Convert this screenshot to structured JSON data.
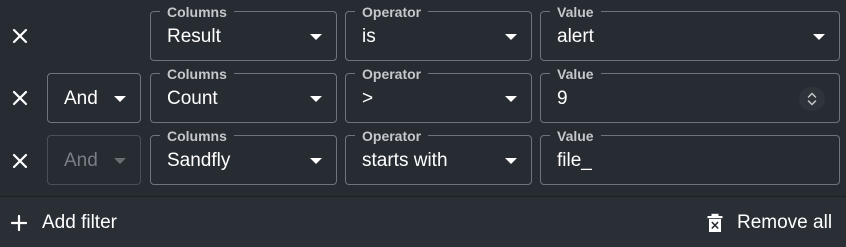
{
  "labels": {
    "columns": "Columns",
    "operator": "Operator",
    "value": "Value"
  },
  "filters": [
    {
      "conjunction": "",
      "column": "Result",
      "operator": "is",
      "value": "alert"
    },
    {
      "conjunction": "And",
      "column": "Count",
      "operator": ">",
      "value": "9"
    },
    {
      "conjunction": "And",
      "column": "Sandfly",
      "operator": "starts with",
      "value": "file_"
    }
  ],
  "footer": {
    "add_label": "Add filter",
    "remove_all_label": "Remove all"
  }
}
